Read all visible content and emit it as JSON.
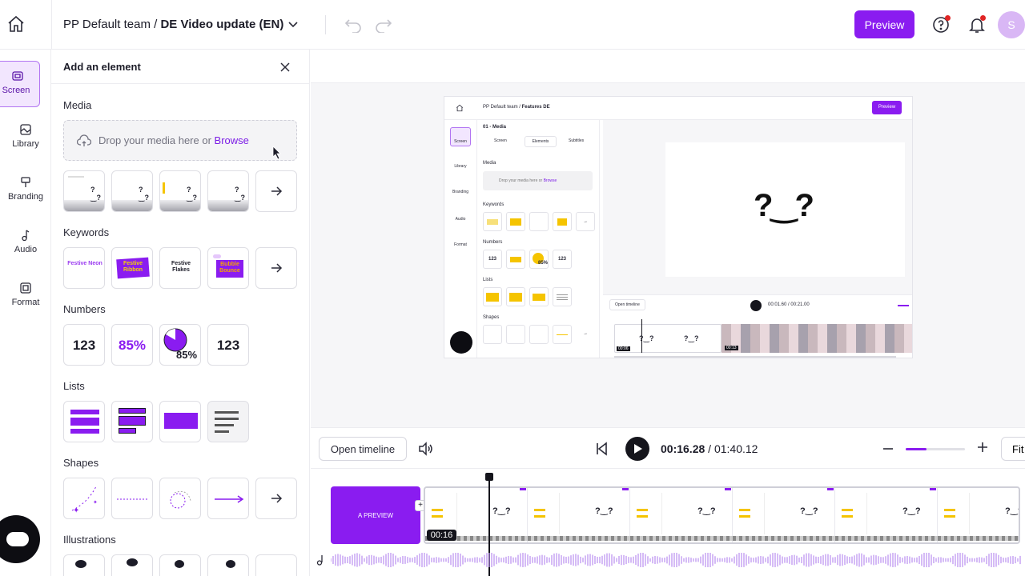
{
  "topbar": {
    "team": "PP Default team /",
    "project": "DE Video update (EN)",
    "preview_label": "Preview",
    "avatar_initial": "S"
  },
  "rail": {
    "items": [
      {
        "label": "Screen",
        "icon": "screen-icon",
        "active": true
      },
      {
        "label": "Library",
        "icon": "library-icon"
      },
      {
        "label": "Branding",
        "icon": "branding-icon"
      },
      {
        "label": "Audio",
        "icon": "audio-icon"
      },
      {
        "label": "Format",
        "icon": "format-icon"
      }
    ]
  },
  "panel": {
    "title": "Add an element",
    "media": {
      "heading": "Media",
      "drop_text": "Drop your media here or",
      "browse": "Browse"
    },
    "keywords": {
      "heading": "Keywords",
      "tiles": [
        "Festive Neon",
        "Festive Ribbon",
        "Festive Flakes",
        "Bubble Bounce"
      ]
    },
    "numbers": {
      "heading": "Numbers",
      "tiles": [
        "123",
        "85%",
        "85%",
        "123"
      ]
    },
    "lists": {
      "heading": "Lists"
    },
    "shapes": {
      "heading": "Shapes"
    },
    "illustrations": {
      "heading": "Illustrations"
    }
  },
  "inner_preview": {
    "team": "PP Default team /",
    "project": "Features DE",
    "preview_label": "Preview",
    "panel_title": "01 - Media",
    "tabs": [
      "Screen",
      "Elements",
      "Subtitles"
    ],
    "sections": [
      "Media",
      "Keywords",
      "Numbers",
      "Lists",
      "Shapes"
    ],
    "drop_text": "Drop your media here or",
    "browse": "Browse",
    "numbers": [
      "123",
      "85%",
      "123"
    ],
    "rail": [
      "Screen",
      "Library",
      "Branding",
      "Audio",
      "Format"
    ],
    "open_timeline": "Open timeline",
    "time": "00:01.60 / 00:21.00",
    "badge_a": "00:06",
    "badge_b": "00:13"
  },
  "controls": {
    "open_timeline": "Open timeline",
    "time_current": "00:16.28",
    "time_total": "/ 01:40.12",
    "zoom_level": 0.35,
    "fit_label": "Fit"
  },
  "timeline": {
    "intro_clip": "A PREVIEW",
    "playhead_badge": "00:16",
    "add_label": "+"
  }
}
